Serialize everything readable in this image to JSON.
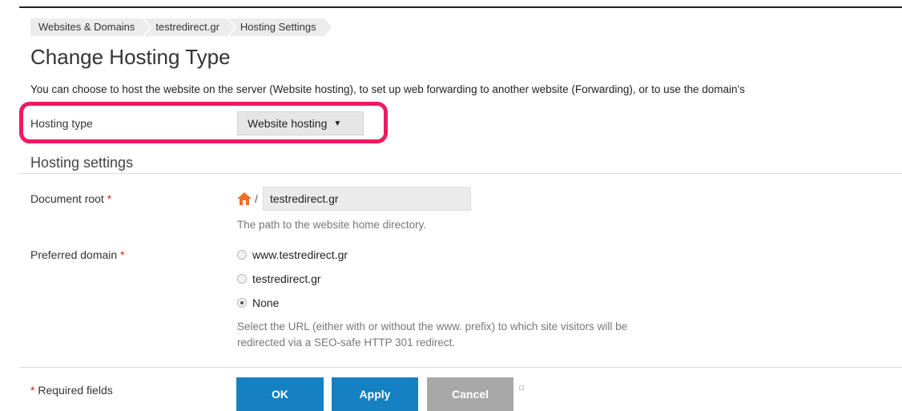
{
  "breadcrumb": [
    "Websites & Domains",
    "testredirect.gr",
    "Hosting Settings"
  ],
  "page_title": "Change Hosting Type",
  "intro": "You can choose to host the website on the server (Website hosting), to set up web forwarding to another website (Forwarding), or to use the domain's",
  "hosting_type": {
    "label": "Hosting type",
    "value": "Website hosting",
    "arrow": "▼"
  },
  "highlight_color": "#ee1a5f",
  "section_title": "Hosting settings",
  "document_root": {
    "label": "Document root",
    "required_mark": "*",
    "icon": "home-icon",
    "prefix": "/",
    "value": "testredirect.gr",
    "hint": "The path to the website home directory."
  },
  "preferred_domain": {
    "label": "Preferred domain",
    "required_mark": "*",
    "options": [
      {
        "label": "www.testredirect.gr",
        "checked": false
      },
      {
        "label": "testredirect.gr",
        "checked": false
      },
      {
        "label": "None",
        "checked": true
      }
    ],
    "hint_line1": "Select the URL (either with or without the www. prefix) to which site visitors will be",
    "hint_line2": "redirected via a SEO-safe HTTP 301 redirect."
  },
  "required_note": {
    "mark": "*",
    "text": "Required fields"
  },
  "buttons": {
    "ok": "OK",
    "apply": "Apply",
    "cancel": "Cancel"
  },
  "colors": {
    "primary_button": "#1681c2",
    "cancel_button": "#a8a8a8",
    "required": "#d02020"
  }
}
